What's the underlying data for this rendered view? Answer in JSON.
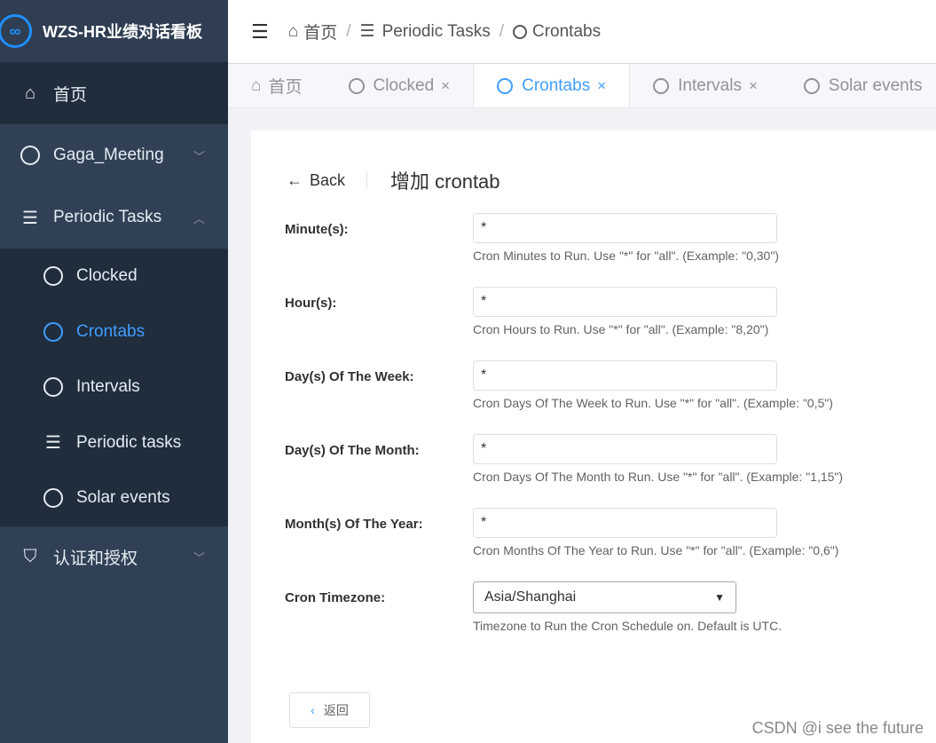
{
  "app": {
    "title": "WZS-HR业绩对话看板",
    "logo_glyph": "∞"
  },
  "sidebar": {
    "items": [
      {
        "label": "首页",
        "icon": "home-icon"
      },
      {
        "label": "Gaga_Meeting",
        "icon": "circle-icon"
      },
      {
        "label": "Periodic Tasks",
        "icon": "list-check-icon",
        "children": [
          {
            "label": "Clocked",
            "icon": "circle-icon"
          },
          {
            "label": "Crontabs",
            "icon": "circle-icon",
            "active": true
          },
          {
            "label": "Intervals",
            "icon": "circle-icon"
          },
          {
            "label": "Periodic tasks",
            "icon": "list-check-icon"
          },
          {
            "label": "Solar events",
            "icon": "circle-icon"
          }
        ]
      },
      {
        "label": "认证和授权",
        "icon": "shield-icon"
      }
    ]
  },
  "breadcrumb": [
    "首页",
    "Periodic Tasks",
    "Crontabs"
  ],
  "tabs": [
    {
      "label": "首页"
    },
    {
      "label": "Clocked"
    },
    {
      "label": "Crontabs",
      "active": true
    },
    {
      "label": "Intervals"
    },
    {
      "label": "Solar events"
    }
  ],
  "page": {
    "back": "Back",
    "title": "增加 crontab"
  },
  "form": [
    {
      "label": "Minute(s):",
      "value": "*",
      "help": "Cron Minutes to Run. Use \"*\" for \"all\". (Example: \"0,30\")"
    },
    {
      "label": "Hour(s):",
      "value": "*",
      "help": "Cron Hours to Run. Use \"*\" for \"all\". (Example: \"8,20\")"
    },
    {
      "label": "Day(s) Of The Week:",
      "value": "*",
      "help": "Cron Days Of The Week to Run. Use \"*\" for \"all\". (Example: \"0,5\")"
    },
    {
      "label": "Day(s) Of The Month:",
      "value": "*",
      "help": "Cron Days Of The Month to Run. Use \"*\" for \"all\". (Example: \"1,15\")"
    },
    {
      "label": "Month(s) Of The Year:",
      "value": "*",
      "help": "Cron Months Of The Year to Run. Use \"*\" for \"all\". (Example: \"0,6\")"
    }
  ],
  "timezone": {
    "label": "Cron Timezone:",
    "value": "Asia/Shanghai",
    "help": "Timezone to Run the Cron Schedule on. Default is UTC."
  },
  "return_button": "返回",
  "watermark": "CSDN @i see the future",
  "colors": {
    "accent": "#409eff",
    "sidebar": "#304156",
    "submenu": "#1f2d3d"
  }
}
